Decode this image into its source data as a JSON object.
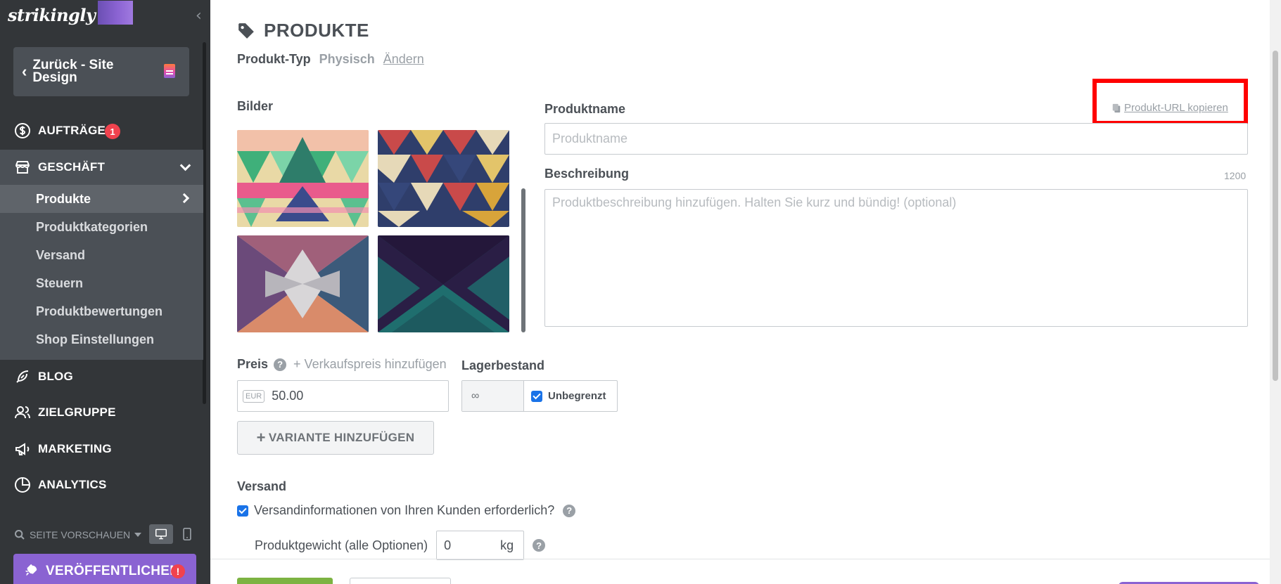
{
  "sidebar": {
    "logo_text": "strikingly",
    "back_label": "Zurück - Site Design",
    "nav": {
      "orders": {
        "label": "AUFTRÄGE",
        "badge": "1"
      },
      "store": {
        "label": "GESCHÄFT"
      },
      "blog": {
        "label": "BLOG"
      },
      "audience": {
        "label": "ZIELGRUPPE"
      },
      "marketing": {
        "label": "MARKETING"
      },
      "analytics": {
        "label": "ANALYTICS"
      }
    },
    "submenu": [
      {
        "label": "Produkte",
        "active": true
      },
      {
        "label": "Produktkategorien"
      },
      {
        "label": "Versand"
      },
      {
        "label": "Steuern"
      },
      {
        "label": "Produktbewertungen"
      },
      {
        "label": "Shop Einstellungen"
      }
    ],
    "preview_label": "SEITE VORSCHAUEN",
    "publish_label": "VERÖFFENTLICHEN",
    "publish_alert": "!"
  },
  "main": {
    "title": "PRODUKTE",
    "product_type_label": "Produkt-Typ",
    "product_type_value": "Physisch",
    "product_type_change": "Ändern",
    "images_label": "Bilder",
    "name_label": "Produktname",
    "name_placeholder": "Produktname",
    "copy_url_label": "Produkt-URL kopieren",
    "desc_label": "Beschreibung",
    "desc_count": "1200",
    "desc_placeholder": "Produktbeschreibung hinzufügen. Halten Sie kurz und bündig! (optional)",
    "price_label": "Preis",
    "sale_price_link": "+ Verkaufspreis hinzufügen",
    "currency": "EUR",
    "price_value": "50.00",
    "stock_label": "Lagerbestand",
    "stock_value": "∞",
    "unlimited_label": "Unbegrenzt",
    "variant_button": "VARIANTE HINZUFÜGEN",
    "shipping_label": "Versand",
    "shipping_check_label": "Versandinformationen von Ihren Kunden erforderlich?",
    "weight_label": "Produktgewicht (alle Optionen)",
    "weight_value": "0",
    "weight_unit": "kg"
  },
  "colors": {
    "sidebar_bg": "#333639",
    "sidebar_active": "#4b5056",
    "accent_purple": "#8a63d2",
    "badge_red": "#f0424e",
    "highlight_red": "#ff0000",
    "save_green": "#7cb342"
  }
}
